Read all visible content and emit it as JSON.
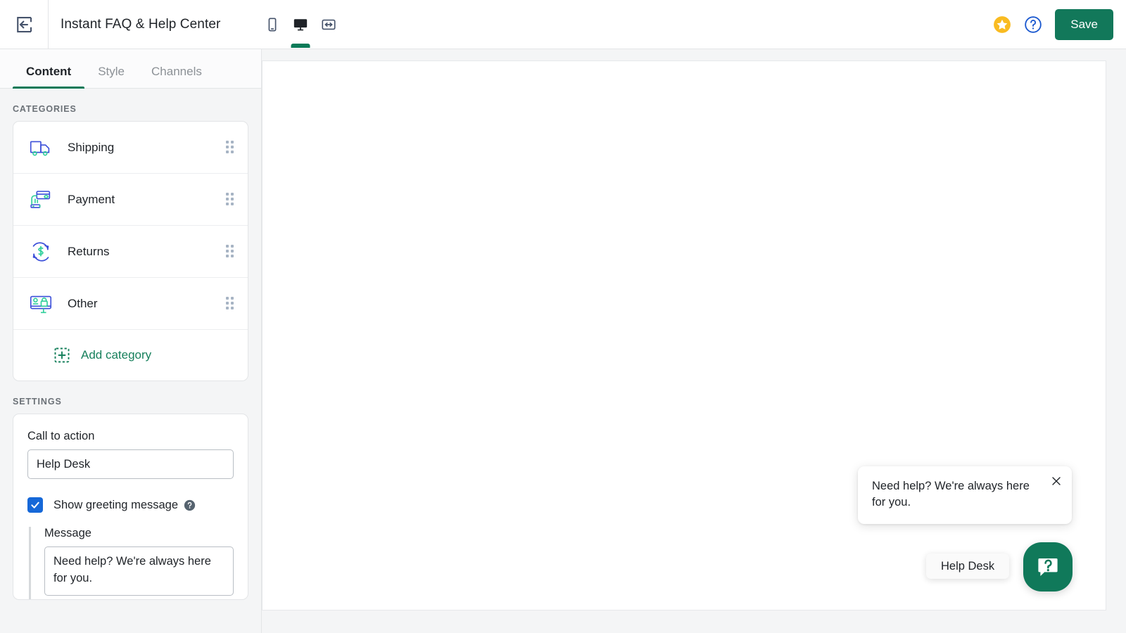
{
  "topbar": {
    "back_icon": "back-arrow-icon",
    "title": "Instant FAQ & Help Center",
    "device_buttons": [
      {
        "name": "mobile-view",
        "icon": "mobile-icon",
        "active": false
      },
      {
        "name": "desktop-view",
        "icon": "desktop-icon",
        "active": true
      },
      {
        "name": "fullwidth-view",
        "icon": "resize-horizontal-icon",
        "active": false
      }
    ],
    "star_icon": "star-icon",
    "help_icon": "question-circle-icon",
    "save_label": "Save",
    "save_color": "#12785a"
  },
  "sidebar": {
    "tabs": [
      {
        "label": "Content",
        "active": true
      },
      {
        "label": "Style",
        "active": false
      },
      {
        "label": "Channels",
        "active": false
      }
    ],
    "categories_label": "CATEGORIES",
    "categories": [
      {
        "label": "Shipping",
        "icon": "delivery-truck-icon"
      },
      {
        "label": "Payment",
        "icon": "credit-card-hand-icon"
      },
      {
        "label": "Returns",
        "icon": "refund-cycle-icon"
      },
      {
        "label": "Other",
        "icon": "monitor-shopping-bag-icon"
      }
    ],
    "add_category_label": "Add category",
    "add_category_icon": "dashed-plus-icon",
    "settings_label": "SETTINGS",
    "settings": {
      "cta_field_label": "Call to action",
      "cta_value": "Help Desk",
      "cta_placeholder": "Call to action",
      "show_greeting_label": "Show greeting message",
      "show_greeting_checked": true,
      "show_greeting_info_icon": "info-question-icon",
      "message_field_label": "Message",
      "message_value": "Need help? We're always here for you.",
      "message_placeholder": "Greeting message"
    }
  },
  "preview": {
    "greeting_text": "Need help? We're always here for you.",
    "close_icon": "close-icon",
    "cta_label": "Help Desk",
    "launcher_icon": "chat-question-icon",
    "launcher_color": "#10795a"
  }
}
